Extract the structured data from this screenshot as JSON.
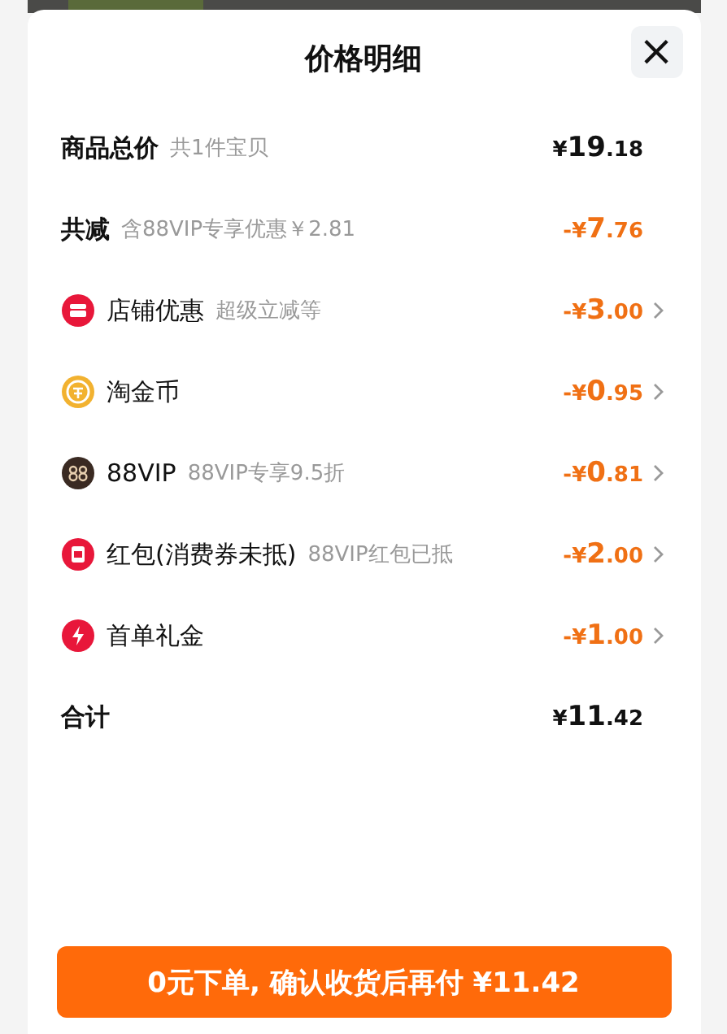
{
  "title": "价格明细",
  "close": "×",
  "rows": [
    {
      "kind": "total",
      "label": "商品总价",
      "note": "共1件宝贝",
      "amount": "¥19.18",
      "arrow": false
    },
    {
      "kind": "discount",
      "label": "共减",
      "note": "含88VIP专享优惠￥2.81",
      "amount": "-¥7.76",
      "arrow": false
    },
    {
      "kind": "item",
      "label": "店铺优惠",
      "note": "超级立减等",
      "amount": "-¥3.00",
      "arrow": true
    },
    {
      "kind": "item",
      "label": "淘金币",
      "amount": "-¥0.95",
      "arrow": true
    },
    {
      "kind": "item",
      "label": "88VIP",
      "note": "88VIP专享9.5折",
      "amount": "-¥0.81",
      "arrow": true
    },
    {
      "kind": "item",
      "label": "红包(消费券未抵)",
      "note": "88VIP红包已抵",
      "amount": "-¥2.00",
      "arrow": true
    },
    {
      "kind": "item",
      "label": "首单礼金",
      "amount": "-¥1.00",
      "arrow": true
    },
    {
      "kind": "total",
      "label": "合计",
      "amount": "¥11.42",
      "arrow": false
    }
  ],
  "cta": "0元下单, 确认收货后再付 ¥11.42"
}
